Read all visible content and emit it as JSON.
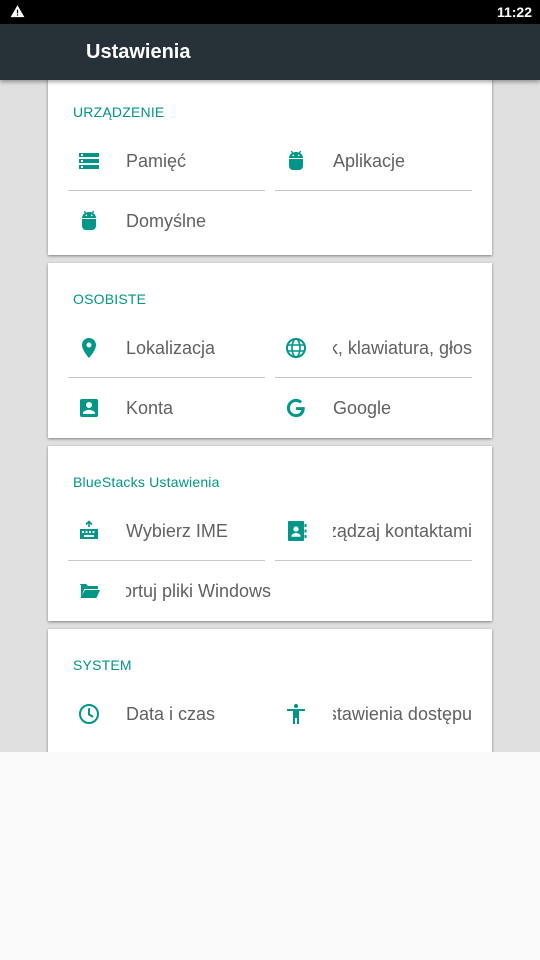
{
  "status_bar": {
    "time": "11:22",
    "icons": [
      "warning-icon"
    ]
  },
  "app_bar": {
    "title": "Ustawienia"
  },
  "colors": {
    "accent": "#009688",
    "app_bar": "#263238",
    "status_bar": "#000000",
    "background": "#e0e0e0",
    "label_text": "#616161"
  },
  "sections": [
    {
      "title": "URZĄDZENIE",
      "items": [
        {
          "label": "Pamięć",
          "icon": "storage-icon"
        },
        {
          "label": "Aplikacje",
          "icon": "android-icon"
        },
        {
          "label": "Domyślne",
          "icon": "android-icon"
        }
      ]
    },
    {
      "title": "OSOBISTE",
      "items": [
        {
          "label": "Lokalizacja",
          "icon": "location-pin-icon"
        },
        {
          "label": "Język, klawiatura, głos",
          "icon": "globe-icon"
        },
        {
          "label": "Konta",
          "icon": "account-box-icon"
        },
        {
          "label": "Google",
          "icon": "google-icon"
        }
      ]
    },
    {
      "title": "BlueStacks Ustawienia",
      "items": [
        {
          "label": "Wybierz IME",
          "icon": "keyboard-icon"
        },
        {
          "label": "Zarządzaj kontaktami",
          "icon": "contacts-icon"
        },
        {
          "label": "Importuj pliki Windows",
          "icon": "folder-open-icon"
        }
      ]
    },
    {
      "title": "SYSTEM",
      "items": [
        {
          "label": "Data i czas",
          "icon": "clock-icon"
        },
        {
          "label": "Ustawienia dostępu",
          "icon": "accessibility-icon"
        }
      ]
    }
  ]
}
